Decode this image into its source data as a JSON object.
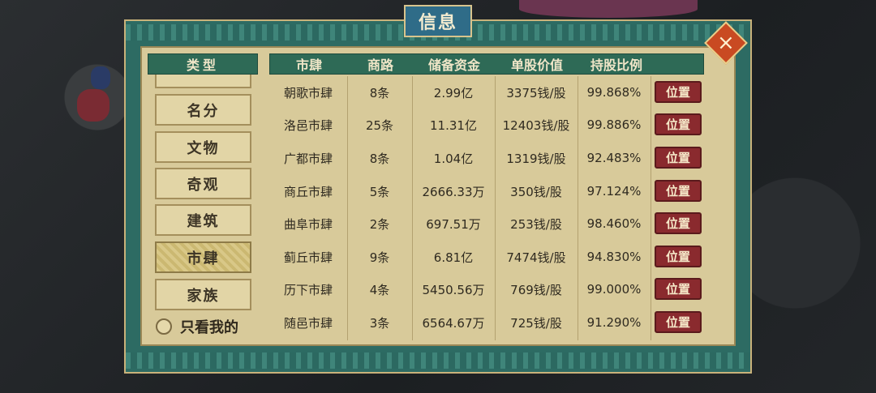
{
  "window": {
    "title": "信息"
  },
  "close": {
    "label": "×"
  },
  "sidebar": {
    "header": "类型",
    "items": [
      {
        "label": "名分"
      },
      {
        "label": "文物"
      },
      {
        "label": "奇观"
      },
      {
        "label": "建筑"
      },
      {
        "label": "市肆"
      },
      {
        "label": "家族"
      }
    ],
    "active": "市肆",
    "only_mine_label": "只看我的"
  },
  "table": {
    "headers": [
      "市肆",
      "商路",
      "储备资金",
      "单股价值",
      "持股比例"
    ],
    "rows": [
      {
        "name": "朝歌市肆",
        "routes": "8条",
        "funds": "2.99亿",
        "share_value": "3375钱/股",
        "ratio": "99.868%",
        "action": "位置"
      },
      {
        "name": "洛邑市肆",
        "routes": "25条",
        "funds": "11.31亿",
        "share_value": "12403钱/股",
        "ratio": "99.886%",
        "action": "位置"
      },
      {
        "name": "广都市肆",
        "routes": "8条",
        "funds": "1.04亿",
        "share_value": "1319钱/股",
        "ratio": "92.483%",
        "action": "位置"
      },
      {
        "name": "商丘市肆",
        "routes": "5条",
        "funds": "2666.33万",
        "share_value": "350钱/股",
        "ratio": "97.124%",
        "action": "位置"
      },
      {
        "name": "曲阜市肆",
        "routes": "2条",
        "funds": "697.51万",
        "share_value": "253钱/股",
        "ratio": "98.460%",
        "action": "位置"
      },
      {
        "name": "蓟丘市肆",
        "routes": "9条",
        "funds": "6.81亿",
        "share_value": "7474钱/股",
        "ratio": "94.830%",
        "action": "位置"
      },
      {
        "name": "历下市肆",
        "routes": "4条",
        "funds": "5450.56万",
        "share_value": "769钱/股",
        "ratio": "99.000%",
        "action": "位置"
      },
      {
        "name": "随邑市肆",
        "routes": "3条",
        "funds": "6564.67万",
        "share_value": "725钱/股",
        "ratio": "91.290%",
        "action": "位置"
      }
    ]
  },
  "colors": {
    "panel": "#2d6b63",
    "parchment": "#d8ca9a",
    "header_green": "#2e6a56",
    "button_red": "#8a2a2e",
    "close_orange": "#c94a22",
    "title_blue": "#2f6c88"
  }
}
